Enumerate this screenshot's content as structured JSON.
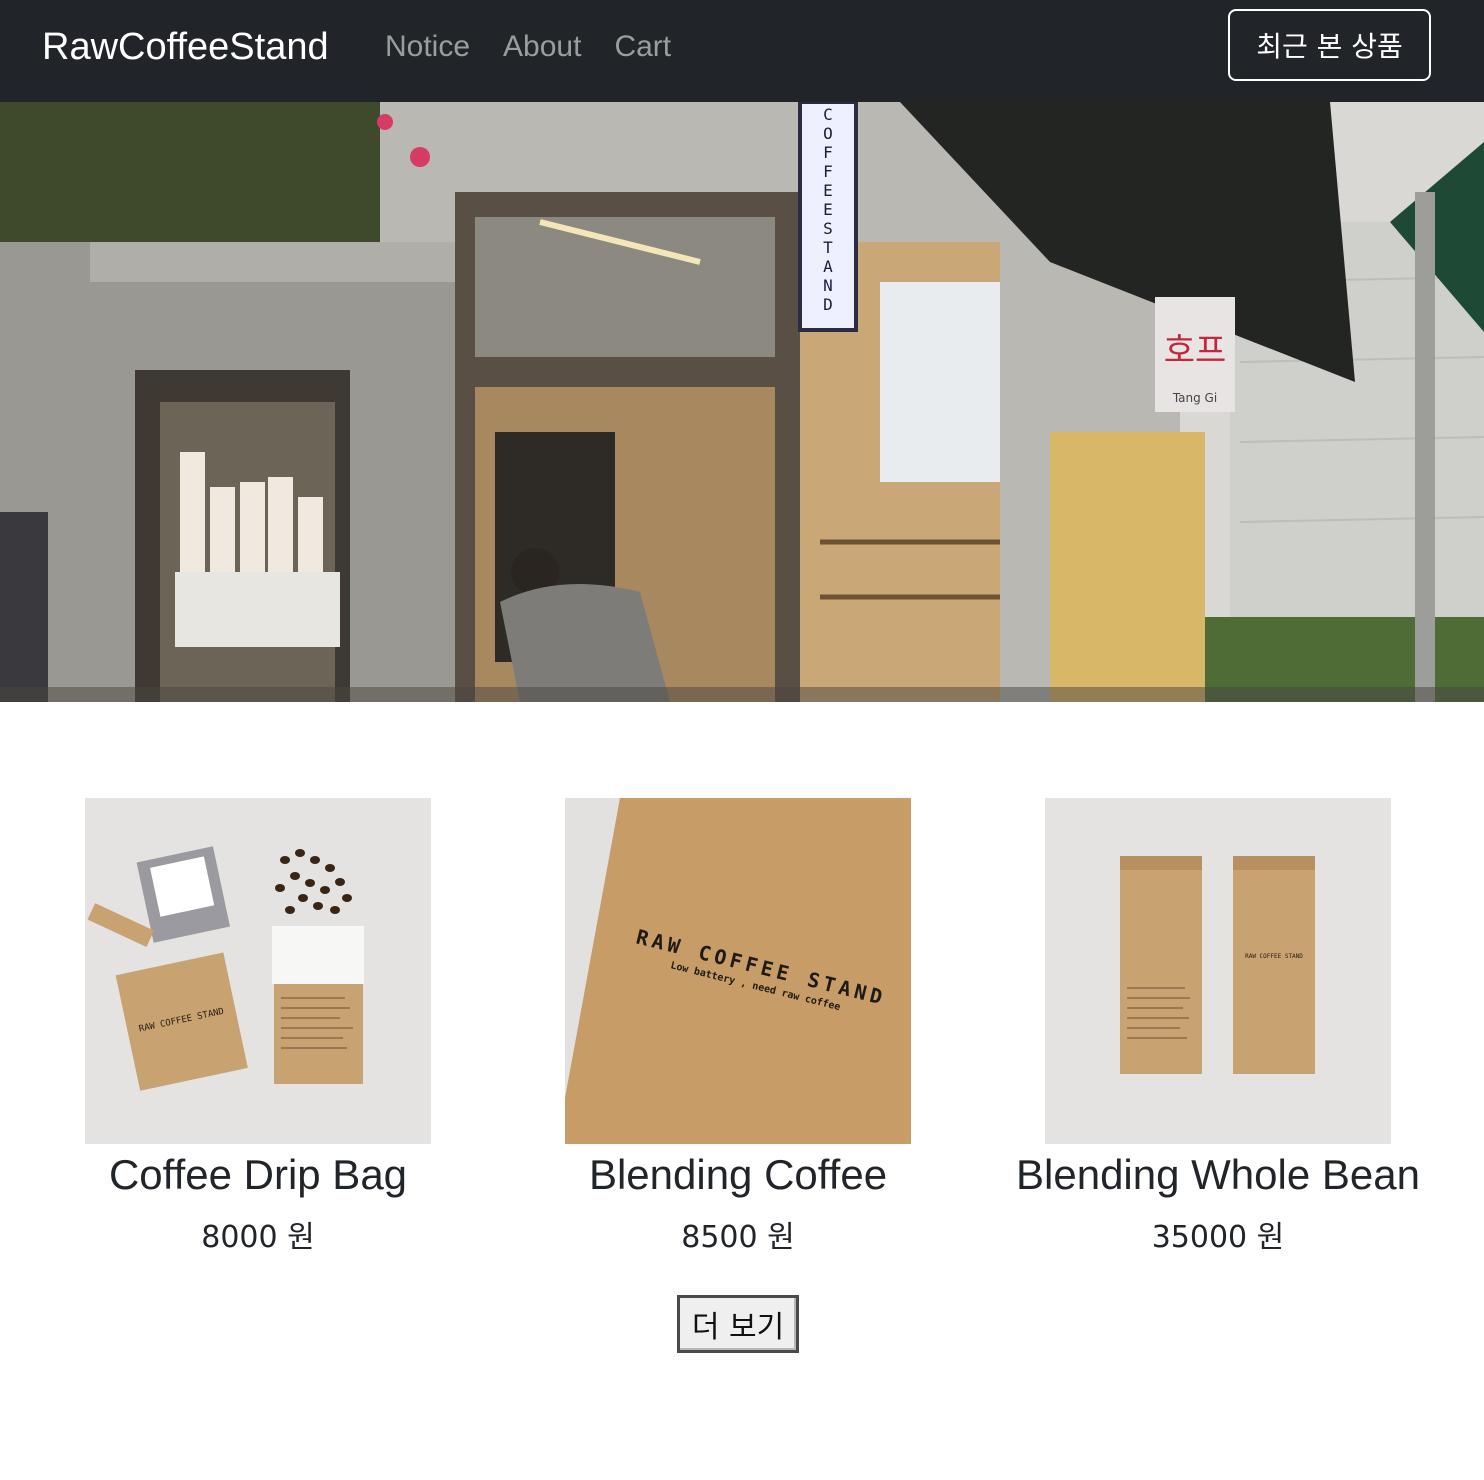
{
  "navbar": {
    "brand": "RawCoffeeStand",
    "links": [
      {
        "label": "Notice"
      },
      {
        "label": "About"
      },
      {
        "label": "Cart"
      }
    ],
    "recent_button_label": "최근 본 상품"
  },
  "hero": {
    "sign_text": "COFFEE STAND",
    "shop_sign_text": "호프",
    "shop_sign_sub": "Tang Gi"
  },
  "products": [
    {
      "name": "Coffee Drip Bag",
      "price": "8000 원",
      "package_text": "RAW COFFEE STAND"
    },
    {
      "name": "Blending Coffee",
      "price": "8500 원",
      "package_text": "RAW COFFEE STAND",
      "package_sub": "Low battery , need raw coffee"
    },
    {
      "name": "Blending Whole Bean",
      "price": "35000 원",
      "package_text": "RAW COFFEE STAND"
    }
  ],
  "more_button_label": "더 보기",
  "colors": {
    "navbar_bg": "#212529",
    "nav_link": "rgba(255,255,255,0.55)",
    "kraft": "#c9a271"
  }
}
